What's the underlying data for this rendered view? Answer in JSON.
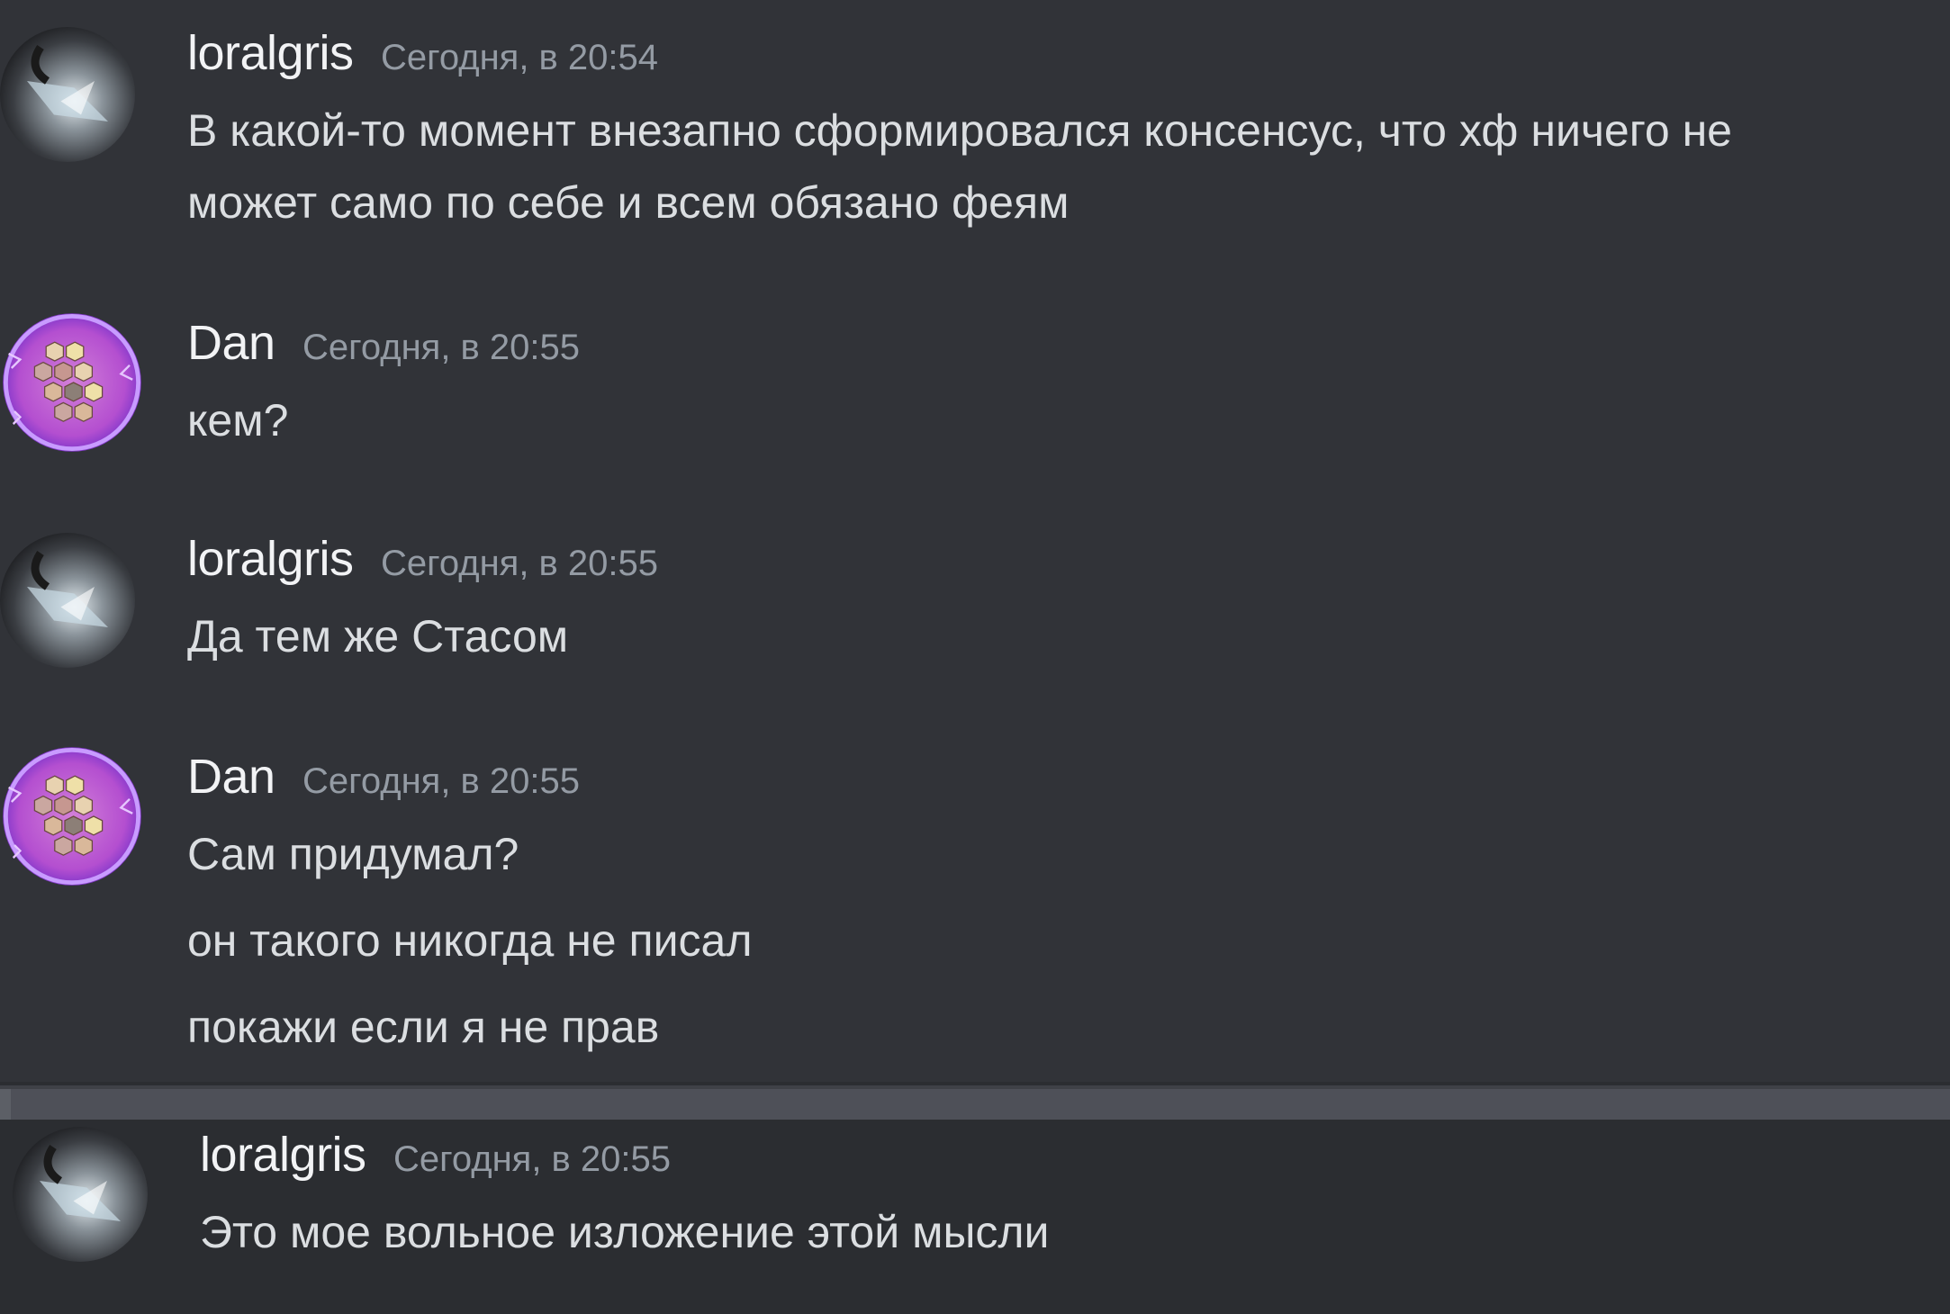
{
  "messages": [
    {
      "author": "loralgris",
      "timestamp": "Сегодня, в 20:54",
      "avatar": "loralgris-avatar",
      "lines": [
        "В какой-то момент внезапно сформировался консенсус, что хф ничего не",
        "может само по себе и всем обязано феям"
      ]
    },
    {
      "author": "Dan",
      "timestamp": "Сегодня, в 20:55",
      "avatar": "dan-avatar",
      "lines": [
        "кем?"
      ]
    },
    {
      "author": "loralgris",
      "timestamp": "Сегодня, в 20:55",
      "avatar": "loralgris-avatar",
      "lines": [
        "Да тем же Стасом"
      ]
    },
    {
      "author": "Dan",
      "timestamp": "Сегодня, в 20:55",
      "avatar": "dan-avatar",
      "lines": [
        "Сам придумал?",
        "он такого никогда не писал",
        "покажи если я не прав"
      ]
    },
    {
      "author": "loralgris",
      "timestamp": "Сегодня, в 20:55",
      "avatar": "loralgris-avatar",
      "lines": [
        "Это мое вольное изложение этой мысли"
      ]
    }
  ],
  "colors": {
    "background": "#313338",
    "author": "#f2f3f5",
    "timestamp": "#949ba4",
    "text": "#dbdee1",
    "dan_avatar_accent": "#a45cff"
  }
}
